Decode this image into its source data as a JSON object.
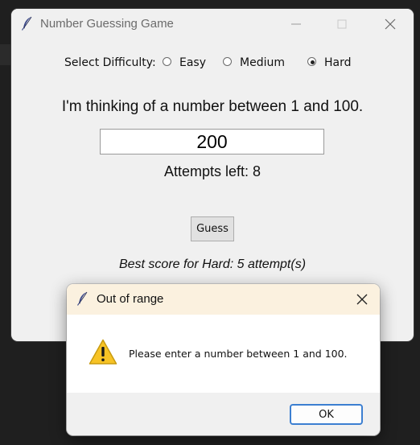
{
  "window": {
    "title": "Number Guessing Game",
    "icon": "feather-icon"
  },
  "difficulty": {
    "label": "Select Difficulty:",
    "options": [
      {
        "label": "Easy",
        "selected": false
      },
      {
        "label": "Medium",
        "selected": false
      },
      {
        "label": "Hard",
        "selected": true
      }
    ]
  },
  "game": {
    "prompt": "I'm thinking of a number between 1 and 100.",
    "guess_value": "200",
    "attempts_text": "Attempts left: 8",
    "guess_button": "Guess",
    "best_score": "Best score for Hard: 5 attempt(s)"
  },
  "dialog": {
    "title": "Out of range",
    "icon": "warning-icon",
    "message": "Please enter a number between 1 and 100.",
    "ok_button": "OK"
  },
  "colors": {
    "dialog_titlebar": "#fbf1df",
    "warning_yellow": "#f7c325",
    "focus_blue": "#3c7fd1"
  }
}
